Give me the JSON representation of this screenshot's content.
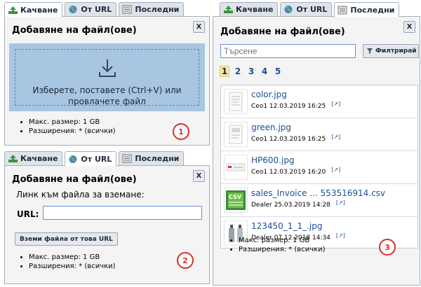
{
  "tabs": {
    "upload": "Качване",
    "from_url": "От URL",
    "recent": "Последни"
  },
  "dialog_title": "Добавяне на файл(ове)",
  "close_label": "X",
  "upload_panel": {
    "drop_text": "Изберете, поставете (Ctrl+V) или провлачете файл",
    "badge": "1"
  },
  "url_panel": {
    "link_label": "Линк към файла за вземане:",
    "url_label": "URL:",
    "url_value": "",
    "fetch_button": "Вземи файла от това URL",
    "badge": "2"
  },
  "recent_panel": {
    "search_placeholder": "Търсене",
    "filter_button": "Филтрирай",
    "pages": [
      "1",
      "2",
      "3",
      "4",
      "5"
    ],
    "current_page": "1",
    "files": [
      {
        "name": "color.jpg",
        "meta": "Ceo1 12.03.2019 16:25",
        "ext": "[↗]"
      },
      {
        "name": "green.jpg",
        "meta": "Ceo1 12.03.2019 16:25",
        "ext": "[↗]"
      },
      {
        "name": "HP600.jpg",
        "meta": "Ceo1 12.03.2019 16:20",
        "ext": "[↗]"
      },
      {
        "name": "sales_Invoice ... 553516914.csv",
        "meta": "Dealer 25.03.2019 14:28",
        "ext": "[↗]"
      },
      {
        "name": "123450_1_1_.jpg",
        "meta": "Dealer 07.12.2018 14:34",
        "ext": "[↗]"
      }
    ],
    "badge": "3"
  },
  "limits": {
    "max_size": "Макс. размер: 1 GB",
    "extensions": "Разширения: * (всички)"
  },
  "colors": {
    "dropzone": "#a8c5e2",
    "badge": "#d9302c",
    "link": "#1d4e9a"
  }
}
